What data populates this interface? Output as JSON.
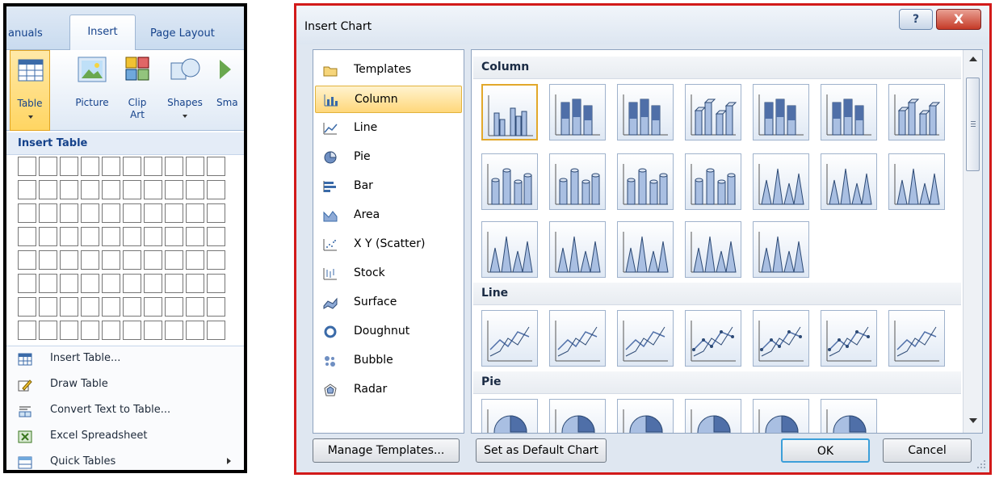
{
  "ribbon": {
    "tabs": [
      "anuals",
      "Insert",
      "Page Layout"
    ],
    "buttons": [
      "Table",
      "Picture",
      "Clip Art",
      "Shapes",
      "Sma"
    ]
  },
  "table_panel": {
    "title": "Insert Table",
    "grid": {
      "columns": 10,
      "rows": 8
    },
    "menu": [
      {
        "label": "Insert Table...",
        "icon": "table-icon"
      },
      {
        "label": "Draw Table",
        "icon": "pencil-icon"
      },
      {
        "label": "Convert Text to Table...",
        "icon": "convert-icon"
      },
      {
        "label": "Excel Spreadsheet",
        "icon": "excel-icon"
      },
      {
        "label": "Quick Tables",
        "icon": "quick-table-icon",
        "has_submenu": true
      }
    ]
  },
  "dialog": {
    "title": "Insert Chart",
    "help": "?",
    "close": "X",
    "chart_types": [
      {
        "label": "Templates",
        "icon": "folder-icon"
      },
      {
        "label": "Column",
        "icon": "column-chart-icon",
        "selected": true
      },
      {
        "label": "Line",
        "icon": "line-chart-icon"
      },
      {
        "label": "Pie",
        "icon": "pie-chart-icon"
      },
      {
        "label": "Bar",
        "icon": "bar-chart-icon"
      },
      {
        "label": "Area",
        "icon": "area-chart-icon"
      },
      {
        "label": "X Y (Scatter)",
        "icon": "scatter-chart-icon"
      },
      {
        "label": "Stock",
        "icon": "stock-chart-icon"
      },
      {
        "label": "Surface",
        "icon": "surface-chart-icon"
      },
      {
        "label": "Doughnut",
        "icon": "doughnut-chart-icon"
      },
      {
        "label": "Bubble",
        "icon": "bubble-chart-icon"
      },
      {
        "label": "Radar",
        "icon": "radar-chart-icon"
      }
    ],
    "gallery": {
      "sections": [
        "Column",
        "Line",
        "Pie"
      ],
      "column_thumb_count": 19,
      "line_thumb_count": 7,
      "pie_thumb_count": 6
    },
    "buttons": {
      "manage": "Manage Templates...",
      "default": "Set as Default Chart",
      "ok": "OK",
      "cancel": "Cancel"
    },
    "accent": "#e2a82a",
    "frame_color": "#d21a1a"
  }
}
